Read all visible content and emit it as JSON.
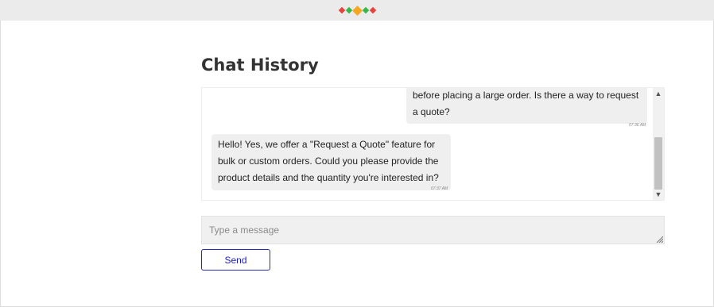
{
  "header": {
    "logo_colors": [
      "#e8423c",
      "#3ab54a",
      "#f5a623",
      "#3ab54a",
      "#e8423c"
    ]
  },
  "chat": {
    "title": "Chat History",
    "messages": [
      {
        "sender": "user",
        "text": "before placing a large order. Is there a way to request a quote?",
        "time": "07:36 AM"
      },
      {
        "sender": "bot",
        "text": "Hello! Yes, we offer a \"Request a Quote\" feature for bulk or custom orders. Could you please provide the product details and the quantity you're interested in?",
        "time": "07:37 AM"
      }
    ]
  },
  "composer": {
    "placeholder": "Type a message",
    "send_label": "Send"
  },
  "icons": {
    "scroll_up": "chevron-up-icon",
    "scroll_down": "chevron-down-icon",
    "resize": "resize-grip-icon"
  }
}
